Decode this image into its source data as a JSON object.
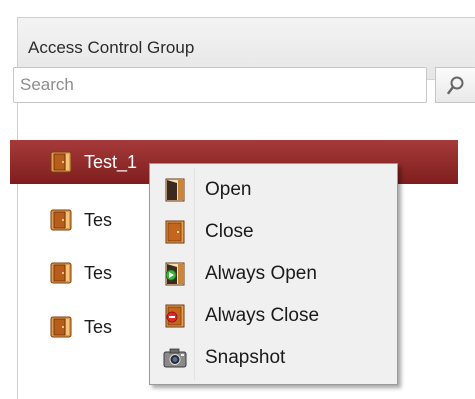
{
  "panel": {
    "title": "Access Control Group"
  },
  "search": {
    "placeholder": "Search"
  },
  "tree": {
    "items": [
      {
        "label": "Test_1",
        "selected": true
      },
      {
        "label": "Tes",
        "selected": false
      },
      {
        "label": "Tes",
        "selected": false
      },
      {
        "label": "Tes",
        "selected": false
      }
    ]
  },
  "context_menu": {
    "items": [
      {
        "label": "Open",
        "icon": "door-open-icon"
      },
      {
        "label": "Close",
        "icon": "door-closed-icon"
      },
      {
        "label": "Always Open",
        "icon": "door-always-open-icon"
      },
      {
        "label": "Always Close",
        "icon": "door-always-close-icon"
      },
      {
        "label": "Snapshot",
        "icon": "camera-icon"
      }
    ]
  },
  "colors": {
    "selected_row": "#8f2b2b",
    "door": "#c8712a",
    "menu_bg": "#f0f0f0"
  }
}
